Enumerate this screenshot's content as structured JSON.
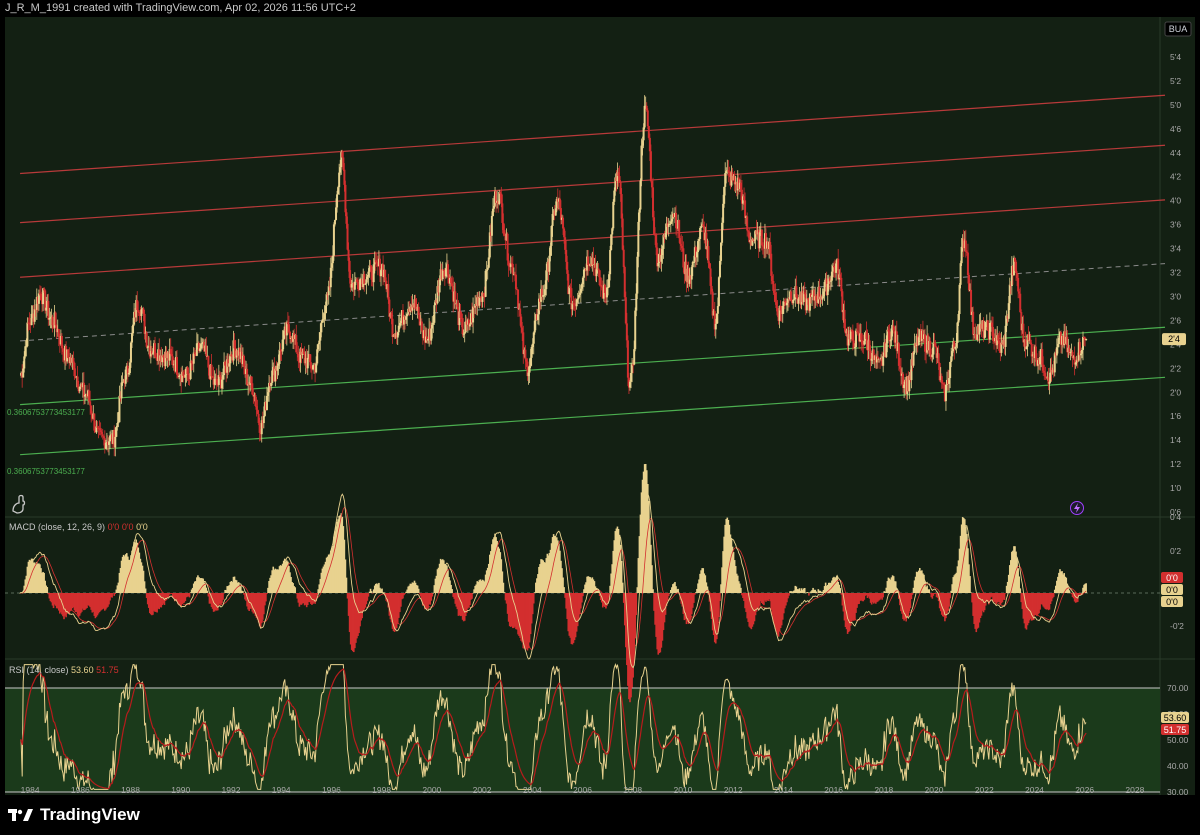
{
  "header": {
    "caption": "J_R_M_1991 created with TradingView.com, Apr 02, 2026 11:56 UTC+2"
  },
  "symbol_badge": "BUA",
  "channel_labels": {
    "upper": "0.3606753773453177",
    "lower": "0.3606753773453177"
  },
  "brand": {
    "name": "TradingView"
  },
  "colors": {
    "bg": "#132013",
    "up": "#e8d28f",
    "down": "#d32f2f",
    "green": "#4caf50",
    "channel_red": "#b83a3a"
  },
  "chart_data": [
    {
      "type": "candlestick",
      "symbol": "BUA",
      "x_range": [
        1983,
        2029
      ],
      "ylim": [
        0.5,
        5.5
      ],
      "last_price": "2'4",
      "y_ticks": [
        "5'4",
        "5'2",
        "5'0",
        "4'6",
        "4'4",
        "4'2",
        "4'0",
        "3'6",
        "3'4",
        "3'2",
        "3'0",
        "2'6",
        "2'4",
        "2'2",
        "2'0",
        "1'6",
        "1'4",
        "1'2",
        "1'0",
        "0'6"
      ],
      "x_ticks": [
        "1984",
        "1986",
        "1988",
        "1990",
        "1992",
        "1994",
        "1996",
        "1998",
        "2000",
        "2002",
        "2004",
        "2006",
        "2008",
        "2010",
        "2012",
        "2014",
        "2016",
        "2018",
        "2020",
        "2022",
        "2024",
        "2026",
        "2028"
      ],
      "key_points": [
        [
          1983.6,
          2.0
        ],
        [
          1984.0,
          2.6
        ],
        [
          1984.4,
          2.9
        ],
        [
          1984.9,
          2.6
        ],
        [
          1985.5,
          2.2
        ],
        [
          1986.2,
          1.8
        ],
        [
          1986.8,
          1.3
        ],
        [
          1987.3,
          1.3
        ],
        [
          1987.8,
          2.0
        ],
        [
          1988.3,
          2.8
        ],
        [
          1988.8,
          2.3
        ],
        [
          1989.5,
          2.2
        ],
        [
          1990.2,
          2.0
        ],
        [
          1990.8,
          2.3
        ],
        [
          1991.4,
          1.9
        ],
        [
          1992.2,
          2.3
        ],
        [
          1992.8,
          1.9
        ],
        [
          1993.2,
          1.45
        ],
        [
          1993.6,
          2.0
        ],
        [
          1994.3,
          2.5
        ],
        [
          1994.8,
          2.2
        ],
        [
          1995.3,
          2.1
        ],
        [
          1995.8,
          2.8
        ],
        [
          1996.4,
          4.35
        ],
        [
          1996.8,
          3.0
        ],
        [
          1997.4,
          3.1
        ],
        [
          1998.0,
          3.2
        ],
        [
          1998.5,
          2.5
        ],
        [
          1999.2,
          2.8
        ],
        [
          1999.8,
          2.4
        ],
        [
          2000.5,
          3.2
        ],
        [
          2001.3,
          2.5
        ],
        [
          2002.0,
          2.9
        ],
        [
          2002.6,
          4.0
        ],
        [
          2003.2,
          3.2
        ],
        [
          2003.8,
          2.1
        ],
        [
          2004.4,
          2.9
        ],
        [
          2005.0,
          3.9
        ],
        [
          2005.6,
          2.8
        ],
        [
          2006.3,
          3.3
        ],
        [
          2006.9,
          2.9
        ],
        [
          2007.4,
          4.2
        ],
        [
          2007.9,
          1.9
        ],
        [
          2008.5,
          4.9
        ],
        [
          2009.0,
          3.3
        ],
        [
          2009.6,
          3.8
        ],
        [
          2010.2,
          3.1
        ],
        [
          2010.8,
          3.6
        ],
        [
          2011.3,
          2.6
        ],
        [
          2011.7,
          4.2
        ],
        [
          2012.2,
          4.1
        ],
        [
          2012.7,
          3.5
        ],
        [
          2013.3,
          3.5
        ],
        [
          2013.8,
          2.7
        ],
        [
          2014.3,
          2.9
        ],
        [
          2014.9,
          2.8
        ],
        [
          2015.5,
          2.9
        ],
        [
          2016.1,
          3.2
        ],
        [
          2016.6,
          2.4
        ],
        [
          2017.2,
          2.4
        ],
        [
          2017.8,
          2.1
        ],
        [
          2018.3,
          2.5
        ],
        [
          2018.9,
          1.9
        ],
        [
          2019.4,
          2.4
        ],
        [
          2020.0,
          2.3
        ],
        [
          2020.4,
          1.8
        ],
        [
          2020.8,
          2.3
        ],
        [
          2021.2,
          3.5
        ],
        [
          2021.6,
          2.5
        ],
        [
          2022.2,
          2.5
        ],
        [
          2022.7,
          2.3
        ],
        [
          2023.2,
          3.2
        ],
        [
          2023.6,
          2.4
        ],
        [
          2024.2,
          2.2
        ],
        [
          2024.6,
          2.0
        ],
        [
          2025.1,
          2.4
        ],
        [
          2025.5,
          2.2
        ],
        [
          2026.1,
          2.4
        ]
      ],
      "channels": {
        "red": [
          {
            "start": [
              1983.6,
              4.22
            ],
            "end": [
              2029.2,
              5.08
            ]
          },
          {
            "start": [
              1983.6,
              3.68
            ],
            "end": [
              2029.2,
              4.53
            ]
          },
          {
            "start": [
              1983.6,
              3.08
            ],
            "end": [
              2029.2,
              3.93
            ]
          }
        ],
        "green": [
          {
            "start": [
              1983.6,
              1.68
            ],
            "end": [
              2029.2,
              2.53
            ]
          },
          {
            "start": [
              1983.6,
              1.13
            ],
            "end": [
              2029.2,
              1.98
            ]
          }
        ],
        "middle_dashed": {
          "start": [
            1983.6,
            2.38
          ],
          "end": [
            2029.2,
            3.23
          ]
        }
      }
    },
    {
      "type": "bar",
      "name": "MACD (close, 12, 26, 9)",
      "label": "MACD (close, 12, 26, 9)",
      "values_text": [
        "0'0",
        "0'0",
        "0'0"
      ],
      "badges": [
        "0'0",
        "0'0",
        "0'0"
      ],
      "y_ticks": [
        "0'4",
        "0'2",
        "-0'2"
      ]
    },
    {
      "type": "line",
      "name": "RSI (14, close)",
      "label": "RSI (14, close)",
      "values_text": [
        "53.60",
        "51.75"
      ],
      "badges": [
        "53.60",
        "51.75"
      ],
      "ylim": [
        30,
        80
      ],
      "y_ticks": [
        "70.00",
        "60.00",
        "50.00",
        "40.00",
        "30.00"
      ],
      "bands": [
        30,
        70
      ]
    }
  ]
}
